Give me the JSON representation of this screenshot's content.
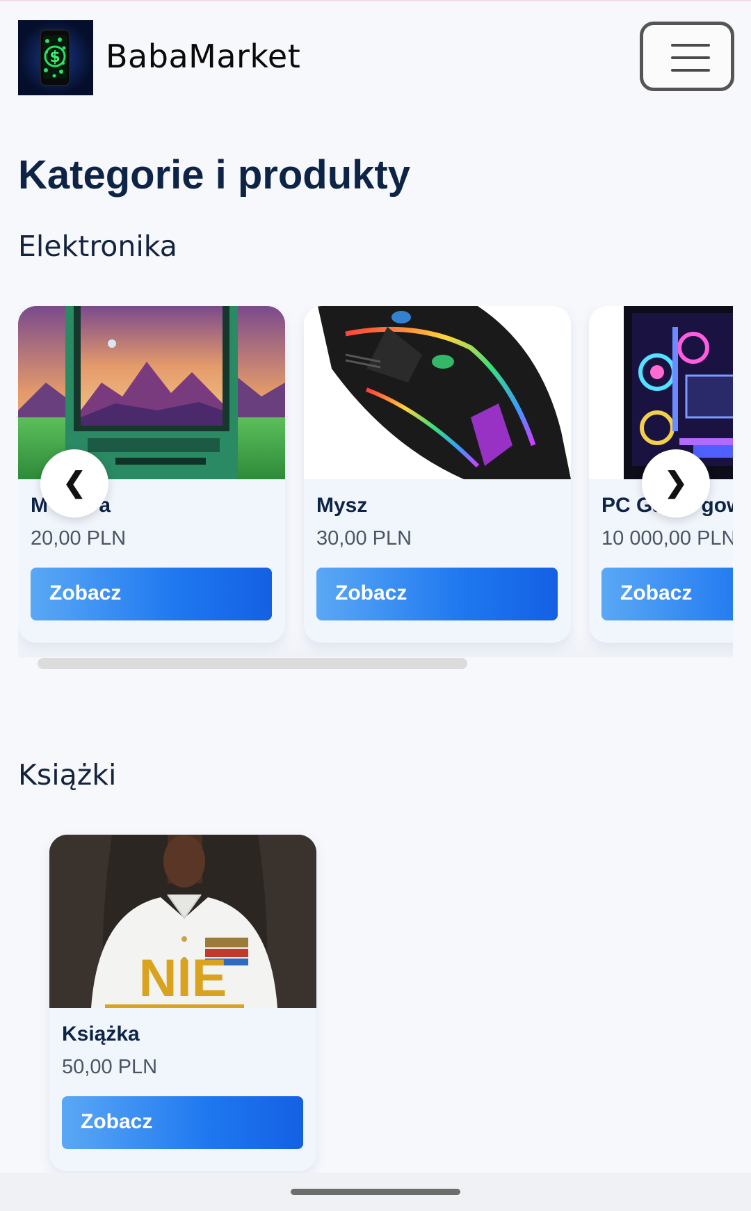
{
  "header": {
    "brand": "BabaMarket",
    "logo_icon": "phone-dollar-icon",
    "menu_icon": "hamburger-menu-icon"
  },
  "page_title": "Kategorie i produkty",
  "categories": [
    {
      "title": "Elektronika",
      "products": [
        {
          "name": "M",
          "name_tail": "a",
          "price": "20,00 PLN",
          "button": "Zobacz",
          "image": "retro-monitor-landscape"
        },
        {
          "name": "Mysz",
          "price": "30,00 PLN",
          "button": "Zobacz",
          "image": "gaming-mouse-rgb"
        },
        {
          "name": "PC Ga",
          "name_tail": "gow",
          "price": "10 000,00 PLN",
          "button": "Zobacz",
          "image": "gaming-pc-rgb"
        }
      ],
      "prev_arrow": "❮",
      "next_arrow": "❯"
    },
    {
      "title": "Książki",
      "products": [
        {
          "name": "Książka",
          "price": "50,00 PLN",
          "button": "Zobacz",
          "image": "book-cover-nie",
          "cover_text": "NIE"
        }
      ]
    }
  ],
  "colors": {
    "title": "#0e2447",
    "button_start": "#5aa8f5",
    "button_end": "#1460e4",
    "background": "#f7f8fb"
  }
}
